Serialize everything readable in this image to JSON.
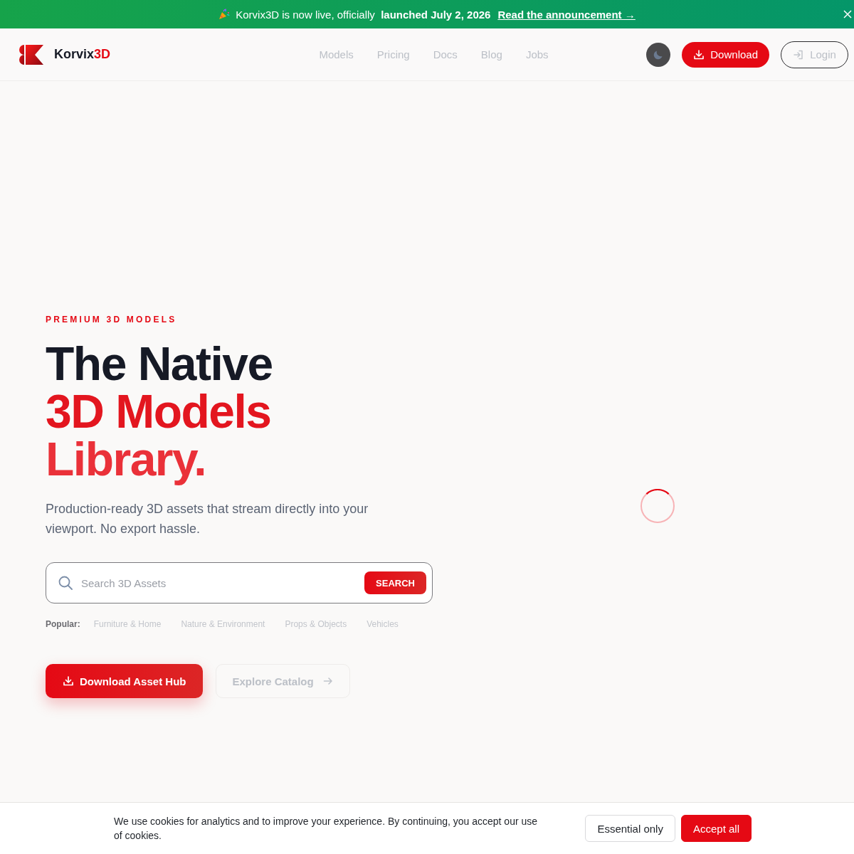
{
  "banner": {
    "message": "Korvix3D is now live, officially  **launched July 2, 2026**",
    "link": "Read the announcement →"
  },
  "header": {
    "brand": {
      "name": "Korvix",
      "accent": "3D"
    },
    "nav": [
      {
        "label": "Models"
      },
      {
        "label": "Pricing"
      },
      {
        "label": "Docs"
      },
      {
        "label": "Blog"
      },
      {
        "label": "Jobs"
      }
    ],
    "download_button": "Download",
    "login_button": "Login"
  },
  "hero": {
    "eyebrow": "PREMIUM 3D MODELS",
    "heading": [
      {
        "text": "The Native",
        "accent": false
      },
      {
        "text": "3D Models",
        "accent": true
      },
      {
        "text": "Library.",
        "accent": true
      }
    ],
    "subtitle": "Production-ready 3D assets that stream directly into your viewport. No export hassle.",
    "search": {
      "placeholder": "Search 3D Assets",
      "button": "SEARCH"
    },
    "popular": {
      "label": "Popular:",
      "tags": [
        "Furniture & Home",
        "Nature & Environment",
        "Props & Objects",
        "Vehicles"
      ]
    },
    "primary_action": "Download Asset Hub",
    "secondary_action": "Explore Catalog"
  },
  "cookie_banner": {
    "message": "We use cookies for analytics and to improve your experience. By continuing, you accept our use of cookies.",
    "buttons": [
      {
        "label": "Essential only",
        "kind": "secondary"
      },
      {
        "label": "Accept all",
        "kind": "primary"
      }
    ]
  }
}
